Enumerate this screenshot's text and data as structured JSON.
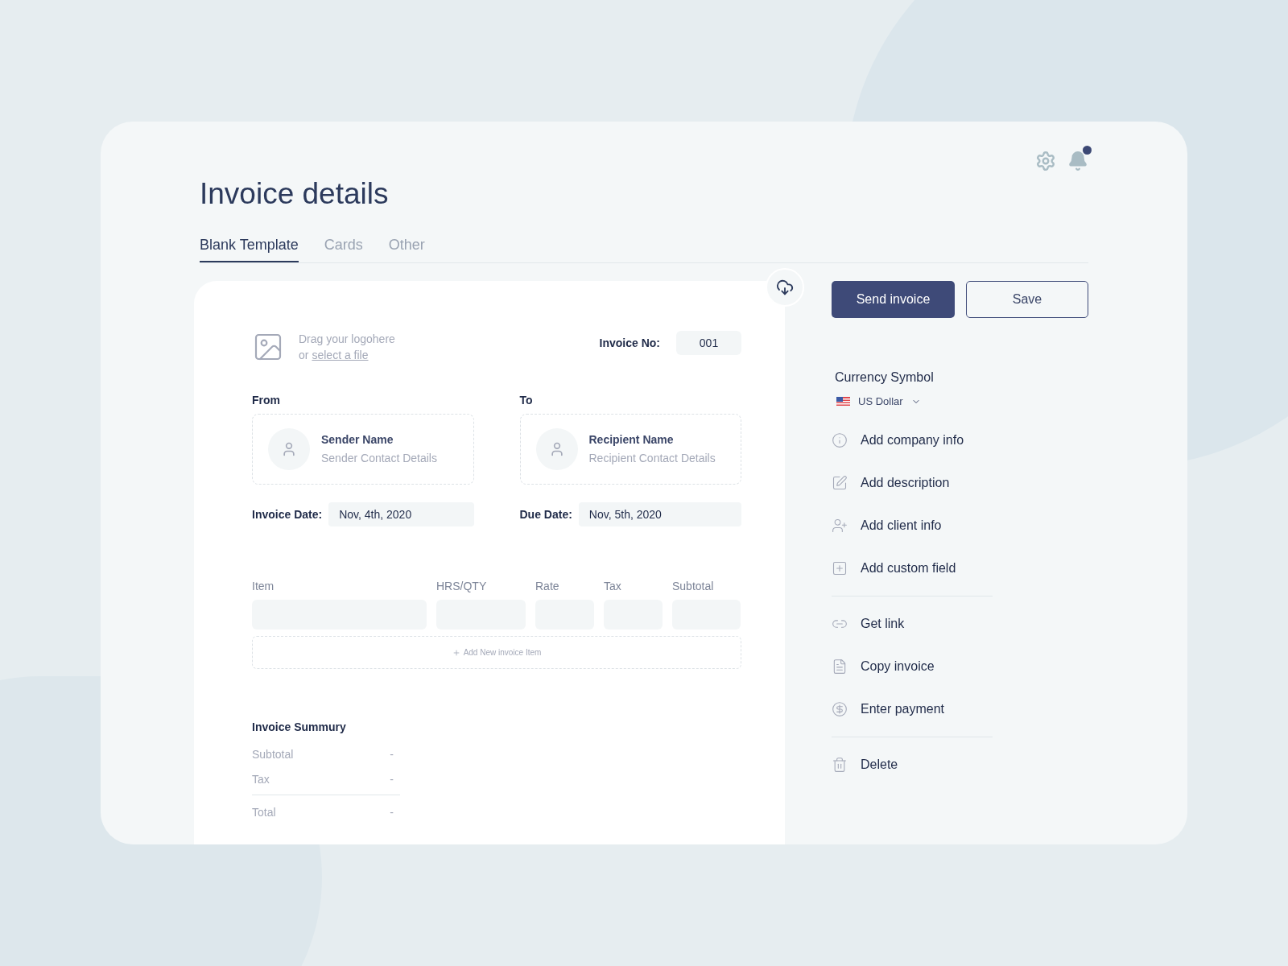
{
  "title": "Invoice details",
  "notifications": {
    "unread": true
  },
  "tabs": [
    {
      "label": "Blank Template",
      "selected": true
    },
    {
      "label": "Cards",
      "selected": false
    },
    {
      "label": "Other",
      "selected": false
    }
  ],
  "logo_drop": {
    "text": "Drag your logohere",
    "prefix": "or",
    "link": "select a file"
  },
  "invoice_no": {
    "label": "Invoice No:",
    "value": "001"
  },
  "parties": [
    {
      "heading": "From",
      "name": "Sender Name",
      "details": "Sender Contact Details"
    },
    {
      "heading": "To",
      "name": "Recipient Name",
      "details": "Recipient Contact Details"
    }
  ],
  "dates": [
    {
      "label": "Invoice Date:",
      "value": "Nov, 4th, 2020"
    },
    {
      "label": "Due Date:",
      "value": "Nov, 5th, 2020"
    }
  ],
  "items_table": {
    "columns": [
      "Item",
      "HRS/QTY",
      "Rate",
      "Tax",
      "Subtotal"
    ],
    "add_button": "Add New invoice Item"
  },
  "summary": {
    "title": "Invoice Summury",
    "rows": [
      {
        "label": "Subtotal",
        "value": "-"
      },
      {
        "label": "Tax",
        "value": "-"
      },
      {
        "label": "Total",
        "value": "-"
      }
    ]
  },
  "buttons": {
    "primary": "Send invoice",
    "secondary": "Save"
  },
  "currency": {
    "label": "Currency Symbol",
    "value": "US Dollar"
  },
  "action_groups": [
    [
      {
        "kind": "info",
        "label": "Add company info"
      },
      {
        "kind": "edit",
        "label": "Add description"
      },
      {
        "kind": "user",
        "label": "Add client info"
      },
      {
        "kind": "field",
        "label": "Add custom field"
      }
    ],
    [
      {
        "kind": "link",
        "label": "Get link"
      },
      {
        "kind": "file",
        "label": "Copy invoice"
      },
      {
        "kind": "payment",
        "label": "Enter payment"
      }
    ],
    [
      {
        "kind": "trash",
        "label": "Delete"
      }
    ]
  ]
}
